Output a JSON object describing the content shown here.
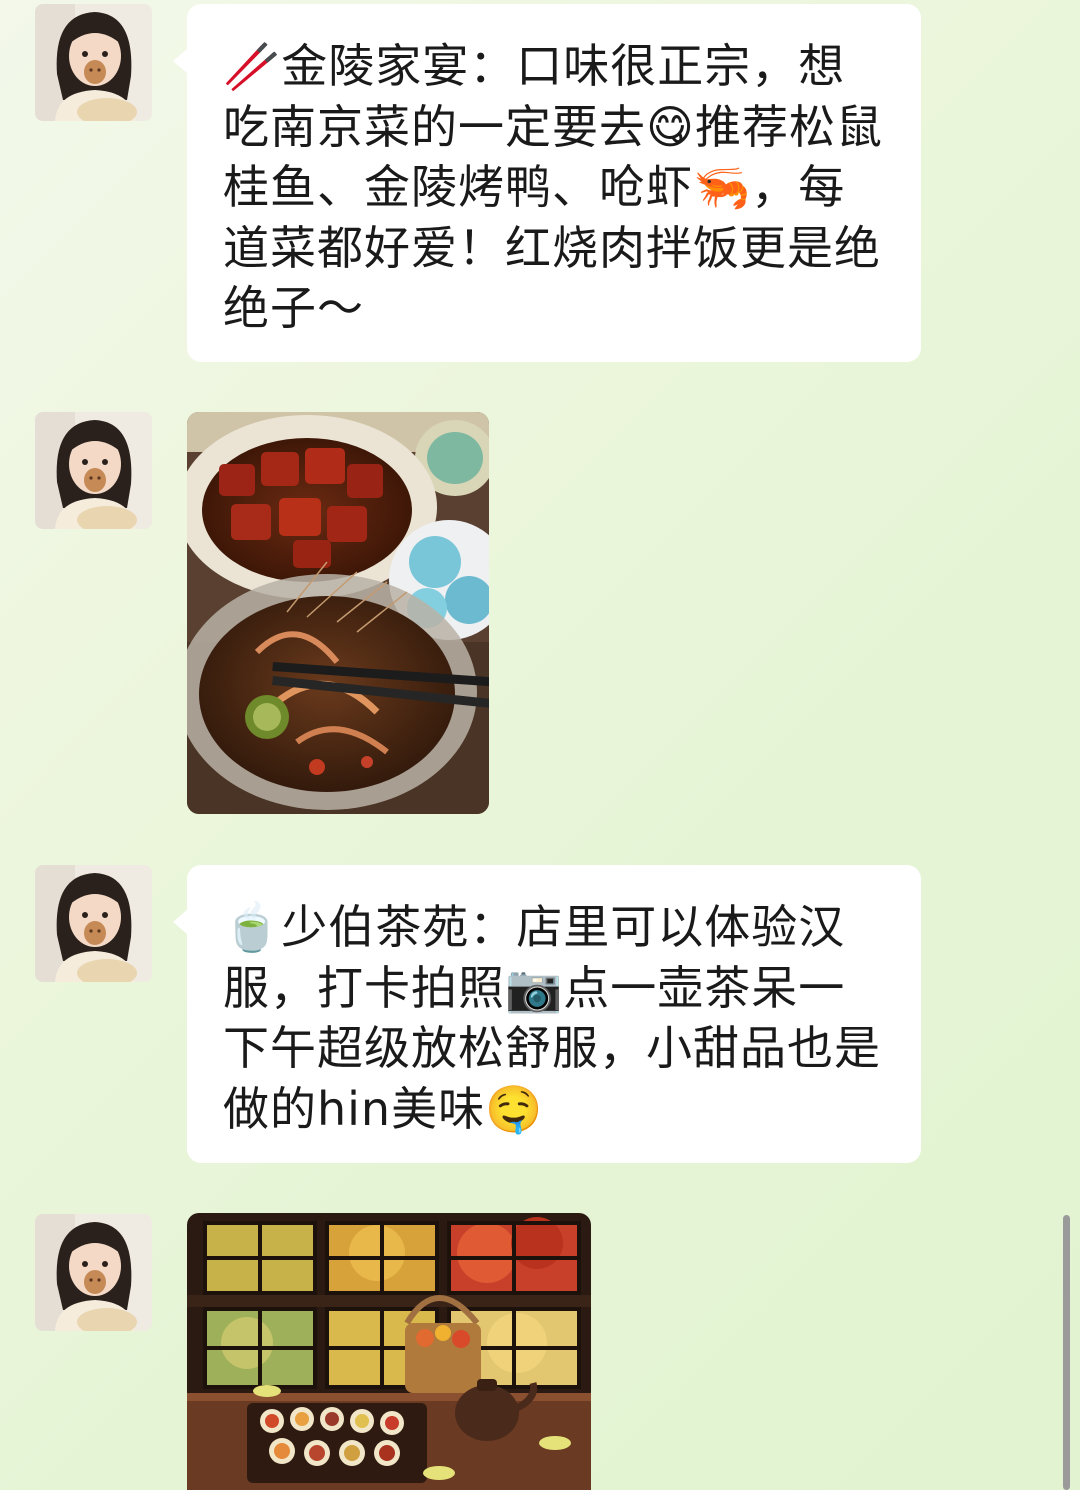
{
  "messages": [
    {
      "type": "text",
      "text": "🥢金陵家宴：口味很正宗，想吃南京菜的一定要去😋推荐松鼠桂鱼、金陵烤鸭、呛虾🦐，每道菜都好爱！红烧肉拌饭更是绝绝子～"
    },
    {
      "type": "image",
      "subject": "braised pork, drunken shrimp and blue dumplings"
    },
    {
      "type": "text",
      "text": "🍵少伯茶苑：店里可以体验汉服，打卡拍照📷点一壶茶呆一下午超级放松舒服，小甜品也是做的hin美味🤤"
    },
    {
      "type": "image",
      "subject": "tea house window with autumn trees and dessert platter"
    }
  ],
  "colors": {
    "chat_background": "#e4f4d4",
    "bubble": "#ffffff",
    "text": "#1a1a1a",
    "scrollbar": "#9a9a9a"
  }
}
